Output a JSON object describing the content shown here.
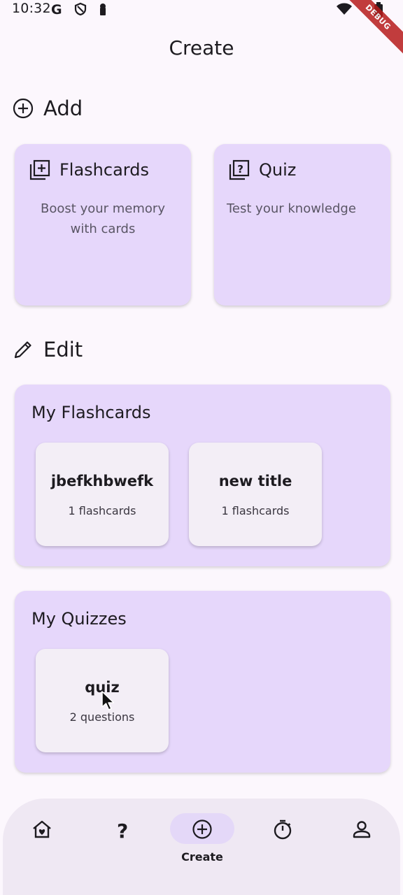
{
  "status_bar": {
    "time": "10:32",
    "debug_label": "DEBUG",
    "icons": [
      "google-icon",
      "shield-icon",
      "lock-icon",
      "wifi-icon",
      "battery-icon"
    ]
  },
  "app_bar": {
    "title": "Create"
  },
  "add_section": {
    "label": "Add",
    "icon": "add-circle-icon",
    "cards": [
      {
        "title": "Flashcards",
        "description": "Boost your memory with cards",
        "icon": "library-add-icon"
      },
      {
        "title": "Quiz",
        "description": "Test your knowledge",
        "icon": "quiz-icon"
      }
    ]
  },
  "edit_section": {
    "label": "Edit",
    "icon": "pencil-icon",
    "flashcards_panel": {
      "title": "My Flashcards",
      "items": [
        {
          "title": "jbefkhbwefk",
          "subtitle": "1 flashcards"
        },
        {
          "title": "new title",
          "subtitle": "1 flashcards"
        }
      ]
    },
    "quizzes_panel": {
      "title": "My Quizzes",
      "items": [
        {
          "title": "quiz",
          "subtitle": "2 questions"
        }
      ]
    }
  },
  "bottom_nav": {
    "items": [
      {
        "id": "home",
        "icon": "home-heart-icon",
        "label": "",
        "selected": false
      },
      {
        "id": "questions",
        "icon": "question-icon",
        "label": "",
        "selected": false
      },
      {
        "id": "create",
        "icon": "add-circle-icon",
        "label": "Create",
        "selected": true
      },
      {
        "id": "timer",
        "icon": "timer-icon",
        "label": "",
        "selected": false
      },
      {
        "id": "profile",
        "icon": "person-icon",
        "label": "",
        "selected": false
      }
    ]
  },
  "colors": {
    "background": "#fcf7fd",
    "card": "#e6d7fb",
    "item_card": "#f3eef6",
    "nav_background": "#efe8f3",
    "nav_selected_pill": "#e4d8f8",
    "text_primary": "#1d1b20",
    "text_secondary": "#5a5665"
  }
}
